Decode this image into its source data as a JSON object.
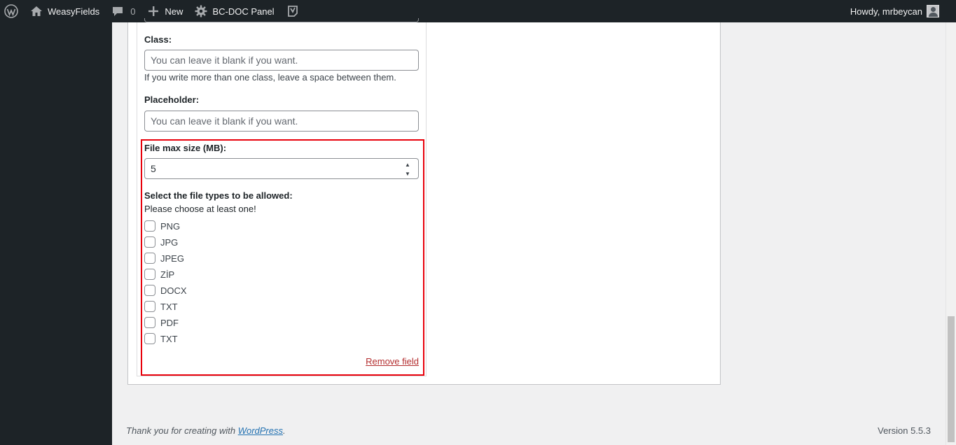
{
  "admin_bar": {
    "wp_logo": "wordpress-logo-icon",
    "site_name": "WeasyFields",
    "comments_count": "0",
    "new_label": "New",
    "panel_label": "BC-DOC Panel",
    "yoast_icon": "yoast-icon",
    "greeting": "Howdy, mrbeycan"
  },
  "form": {
    "class_label": "Class:",
    "class_placeholder": "You can leave it blank if you want.",
    "class_hint": "If you write more than one class, leave a space between them.",
    "placeholder_label": "Placeholder:",
    "placeholder_placeholder": "You can leave it blank if you want.",
    "max_size_label": "File max size (MB):",
    "max_size_value": "5",
    "file_types_label": "Select the file types to be allowed:",
    "file_types_hint": "Please choose at least one!",
    "file_types": [
      "PNG",
      "JPG",
      "JPEG",
      "ZİP",
      "DOCX",
      "TXT",
      "PDF",
      "TXT"
    ],
    "remove_field": "Remove field"
  },
  "footer": {
    "thanks_prefix": "Thank you for creating with ",
    "wordpress_link": "WordPress",
    "thanks_suffix": ".",
    "version": "Version 5.5.3"
  },
  "colors": {
    "admin_bar_bg": "#1d2327",
    "highlight_border": "#e8000b",
    "link": "#2271b1",
    "remove_link": "#b32d2e"
  }
}
